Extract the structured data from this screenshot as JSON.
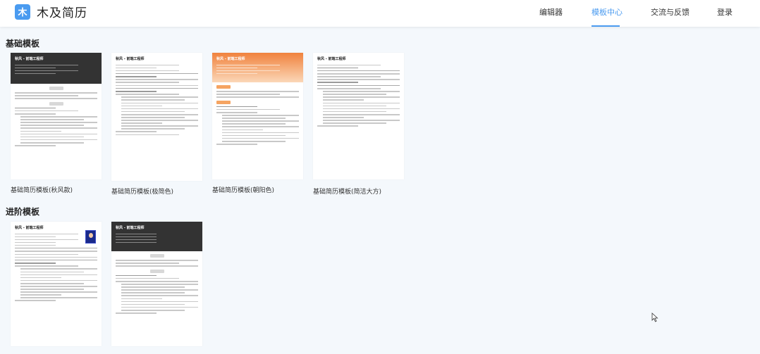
{
  "header": {
    "logo_badge": "木",
    "logo_text": "木及简历",
    "nav": [
      {
        "label": "编辑器"
      },
      {
        "label": "模板中心"
      },
      {
        "label": "交流与反馈"
      },
      {
        "label": "登录"
      }
    ],
    "accent_color": "#4a9bf0"
  },
  "sections": [
    {
      "title": "基础模板",
      "cards": [
        {
          "caption": "基础简历模板(秋风款)",
          "preview_name": "秋风 - 前端工程师",
          "style": "dark"
        },
        {
          "caption": "基础简历模板(极简色)",
          "preview_name": "秋风 - 前端工程师",
          "style": "plain"
        },
        {
          "caption": "基础简历模板(朝阳色)",
          "preview_name": "秋风 - 前端工程师",
          "style": "orange"
        },
        {
          "caption": "基础简历模板(简洁大方)",
          "preview_name": "秋风 - 前端工程师",
          "style": "simple"
        }
      ]
    },
    {
      "title": "进阶模板",
      "cards": [
        {
          "caption": "",
          "preview_name": "秋风 - 前端工程师",
          "style": "photo"
        },
        {
          "caption": "",
          "preview_name": "秋风 - 前端工程师",
          "style": "dark-advanced"
        }
      ]
    }
  ],
  "icons": [
    "cursor-icon"
  ]
}
